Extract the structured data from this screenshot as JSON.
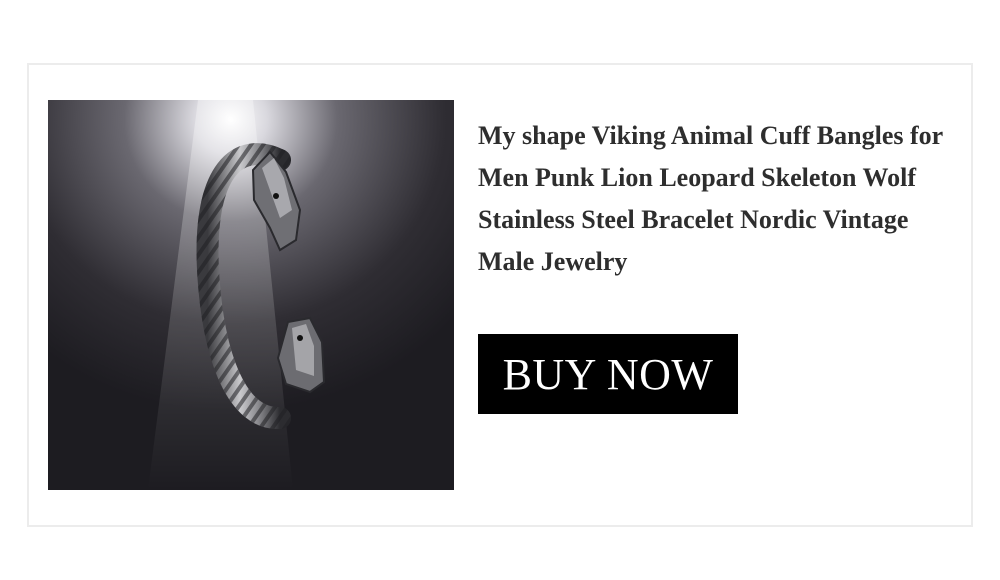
{
  "product": {
    "title": "My shape Viking Animal Cuff Bangles for Men Punk Lion Leopard Skeleton Wolf Stainless Steel Bracelet Nordic Vintage Male Jewelry",
    "image_icon": "wolf-head-bracelet-photo"
  },
  "cta": {
    "label": "BUY NOW"
  },
  "colors": {
    "button_bg": "#000000",
    "button_text": "#ffffff",
    "title_text": "#2e2e2e",
    "card_border": "#ececec",
    "photo_bg": "#262429"
  }
}
